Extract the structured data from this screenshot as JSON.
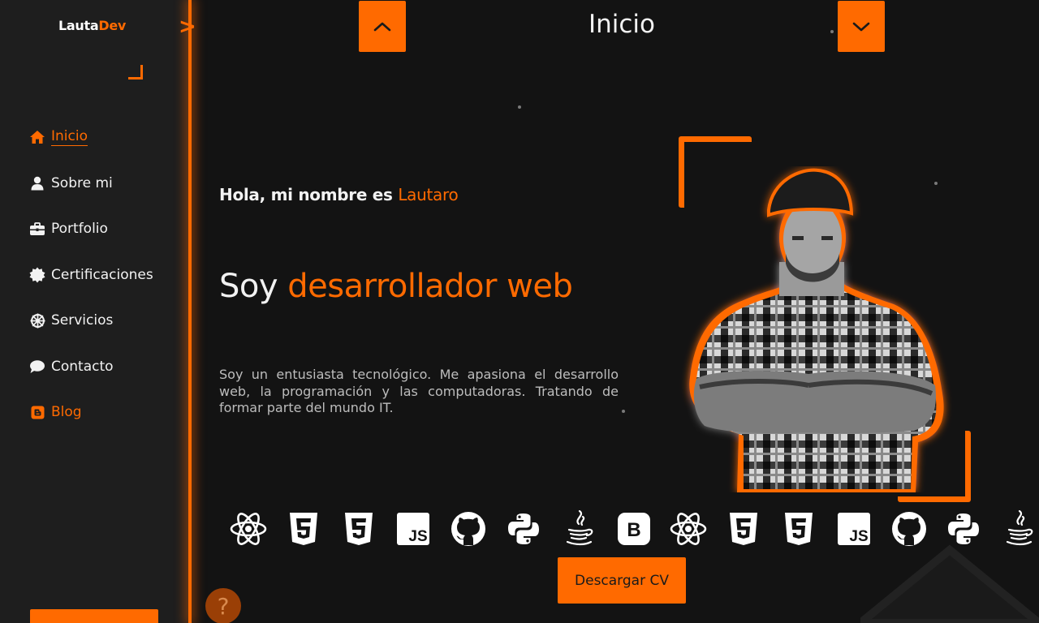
{
  "brand": {
    "name_main": "Lauta",
    "name_accent": "Dev",
    "toggle_glyph": ">"
  },
  "sidebar": {
    "items": [
      {
        "label": "Inicio",
        "icon": "home-icon",
        "active": true
      },
      {
        "label": "Sobre mi",
        "icon": "user-icon"
      },
      {
        "label": "Portfolio",
        "icon": "briefcase-icon"
      },
      {
        "label": "Certificaciones",
        "icon": "certificate-icon"
      },
      {
        "label": "Servicios",
        "icon": "wheel-icon"
      },
      {
        "label": "Contacto",
        "icon": "chat-icon"
      },
      {
        "label": "Blog",
        "icon": "blogger-icon",
        "highlight": true
      }
    ]
  },
  "header": {
    "title": "Inicio",
    "prev_icon": "chevron-up-icon",
    "next_icon": "chevron-down-icon"
  },
  "hero": {
    "greeting_prefix": "Hola, mi nombre es ",
    "greeting_name": "Lautaro",
    "headline_prefix": "Soy ",
    "headline_role": "desarrollador web",
    "bio": "Soy un entusiasta tecnológico. Me apasiona el desarrollo web, la programación y las computadoras. Tratando de formar parte del mundo IT."
  },
  "tech_icons": [
    "react-icon",
    "html5-icon",
    "css3-icon",
    "javascript-icon",
    "github-icon",
    "python-icon",
    "java-icon",
    "bootstrap-icon",
    "react-icon",
    "html5-icon",
    "css3-icon",
    "javascript-icon",
    "github-icon",
    "python-icon",
    "java-icon"
  ],
  "cta": {
    "download_cv": "Descargar CV"
  },
  "help": {
    "glyph": "?"
  },
  "colors": {
    "accent": "#ff6a00",
    "background": "#131313",
    "sidebar": "#1e1e1e",
    "text": "#f2f2f2"
  }
}
